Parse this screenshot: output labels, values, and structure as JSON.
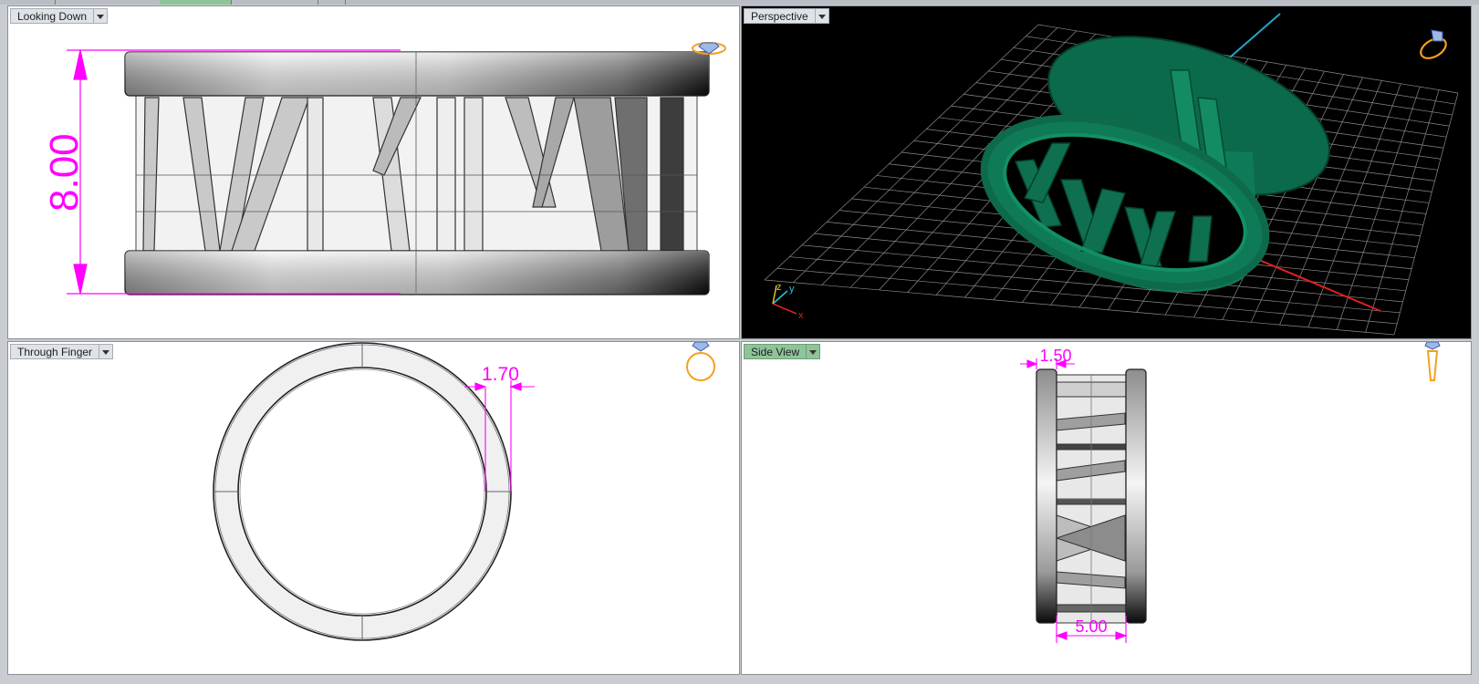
{
  "viewports": {
    "looking_down": {
      "label": "Looking Down",
      "dimension": "8.00"
    },
    "perspective": {
      "label": "Perspective",
      "axis_x": "x",
      "axis_y": "y",
      "axis_z": "z"
    },
    "through_finger": {
      "label": "Through Finger",
      "dimension": "1.70"
    },
    "side_view": {
      "label": "Side View",
      "dimension_top": "1.50",
      "dimension_bottom": "5.00"
    }
  },
  "colors": {
    "dimension": "#ff00ff",
    "ring_green": "#0f7a57",
    "active_view": "#8fc49a",
    "view_icon": "#f5a020"
  },
  "icons": [
    "ring-orientation-icon",
    "dropdown-arrow-icon"
  ]
}
